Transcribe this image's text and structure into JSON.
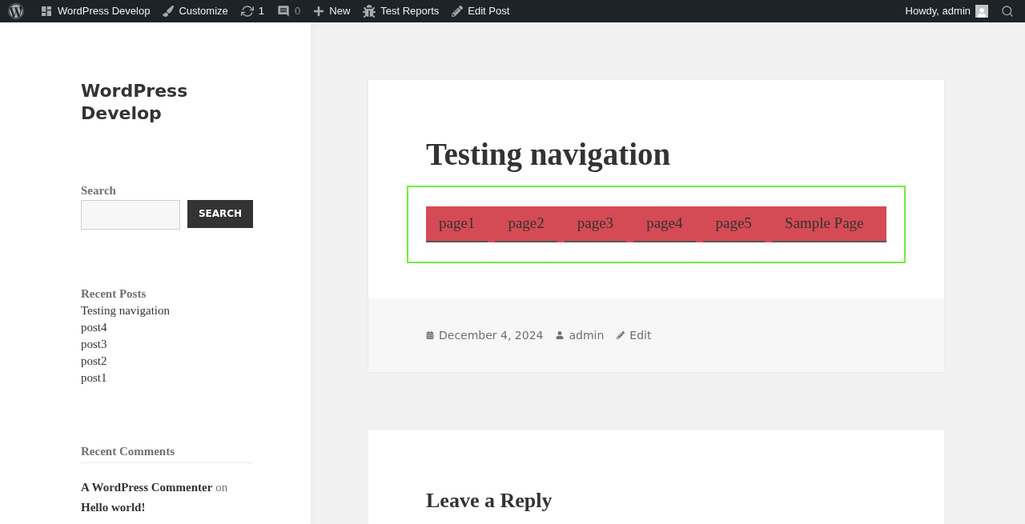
{
  "admin_bar": {
    "items": [
      {
        "kind": "logo"
      },
      {
        "kind": "site",
        "label": "WordPress Develop"
      },
      {
        "kind": "customize",
        "label": "Customize"
      },
      {
        "kind": "updates",
        "label": "1"
      },
      {
        "kind": "comments",
        "label": "0"
      },
      {
        "kind": "new",
        "label": "New"
      },
      {
        "kind": "reports",
        "label": "Test Reports"
      },
      {
        "kind": "edit",
        "label": "Edit Post"
      }
    ],
    "account": {
      "label": "Howdy, admin"
    }
  },
  "sidebar": {
    "site_title": "WordPress Develop",
    "search": {
      "label": "Search",
      "button": "SEARCH"
    },
    "recent_posts": {
      "title": "Recent Posts",
      "items": [
        "Testing navigation",
        "post4",
        "post3",
        "post2",
        "post1"
      ]
    },
    "recent_comments": {
      "title": "Recent Comments",
      "items": [
        {
          "author": "A WordPress Commenter",
          "connector": "on",
          "post": "Hello world!"
        }
      ]
    }
  },
  "post": {
    "title": "Testing navigation",
    "menu": [
      "page1",
      "page2",
      "page3",
      "page4",
      "page5",
      "Sample Page"
    ],
    "meta": {
      "date": "December 4, 2024",
      "author": "admin",
      "edit": "Edit"
    }
  },
  "reply": {
    "title": "Leave a Reply"
  }
}
